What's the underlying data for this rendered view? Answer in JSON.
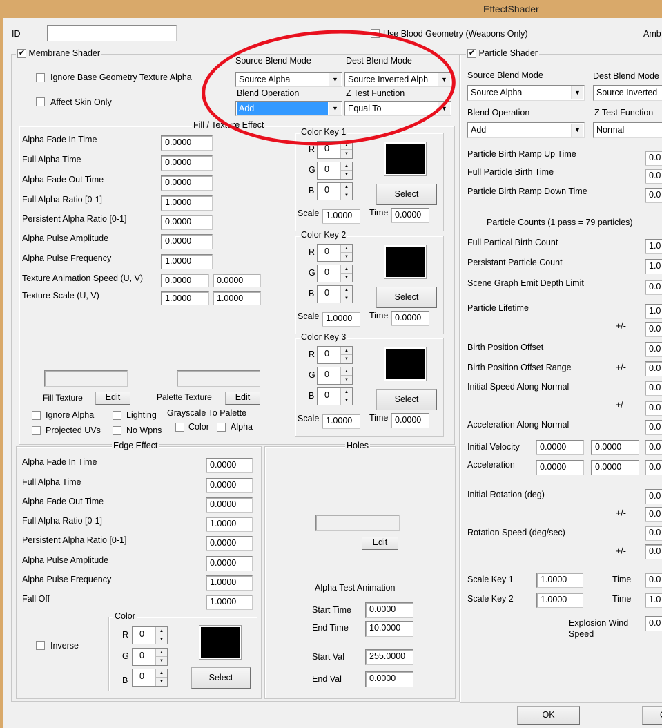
{
  "window": {
    "title": "EffectShader"
  },
  "top": {
    "id_label": "ID",
    "id_value": "",
    "use_blood_geometry": {
      "label": "Use Blood Geometry (Weapons Only)",
      "checked": false
    },
    "ambient_label": "Amb"
  },
  "membrane": {
    "label": "Membrane Shader",
    "checked": true,
    "ignore_base_geometry": {
      "label": "Ignore Base Geometry Texture Alpha",
      "checked": false
    },
    "affect_skin_only": {
      "label": "Affect Skin Only",
      "checked": false
    },
    "source_blend_label": "Source Blend Mode",
    "source_blend_value": "Source Alpha",
    "dest_blend_label": "Dest Blend Mode",
    "dest_blend_value": "Source Inverted Alph",
    "blend_op_label": "Blend Operation",
    "blend_op_value": "Add",
    "ztest_label": "Z Test Function",
    "ztest_value": "Equal To",
    "fill": {
      "title": "Fill / Texture Effect",
      "rows": [
        {
          "label": "Alpha Fade In Time",
          "value": "0.0000"
        },
        {
          "label": "Full Alpha Time",
          "value": "0.0000"
        },
        {
          "label": "Alpha Fade Out Time",
          "value": "0.0000"
        },
        {
          "label": "Full Alpha Ratio [0-1]",
          "value": "1.0000"
        },
        {
          "label": "Persistent Alpha Ratio [0-1]",
          "value": "0.0000"
        },
        {
          "label": "Alpha Pulse Amplitude",
          "value": "0.0000"
        },
        {
          "label": "Alpha Pulse Frequency",
          "value": "1.0000"
        }
      ],
      "anim_speed": {
        "label": "Texture Animation Speed (U, V)",
        "u": "0.0000",
        "v": "0.0000"
      },
      "tex_scale": {
        "label": "Texture Scale (U, V)",
        "u": "1.0000",
        "v": "1.0000"
      },
      "fill_texture_label": "Fill Texture",
      "fill_texture_value": "",
      "palette_texture_label": "Palette Texture",
      "palette_texture_value": "",
      "edit_label": "Edit",
      "ignore_alpha": {
        "label": "Ignore Alpha",
        "checked": false
      },
      "lighting": {
        "label": "Lighting",
        "checked": false
      },
      "projected_uvs": {
        "label": "Projected UVs",
        "checked": false
      },
      "no_wpns": {
        "label": "No Wpns",
        "checked": false
      },
      "grayscale_label": "Grayscale To Palette",
      "gs_color": {
        "label": "Color",
        "checked": false
      },
      "gs_alpha": {
        "label": "Alpha",
        "checked": false
      }
    },
    "color_keys": [
      {
        "title": "Color Key 1",
        "r": "0",
        "g": "0",
        "b": "0",
        "scale": "1.0000",
        "time": "0.0000",
        "color": "#000000"
      },
      {
        "title": "Color Key 2",
        "r": "0",
        "g": "0",
        "b": "0",
        "scale": "1.0000",
        "time": "0.0000",
        "color": "#000000"
      },
      {
        "title": "Color Key 3",
        "r": "0",
        "g": "0",
        "b": "0",
        "scale": "1.0000",
        "time": "0.0000",
        "color": "#000000"
      }
    ],
    "ck_labels": {
      "r": "R",
      "g": "G",
      "b": "B",
      "scale": "Scale",
      "time": "Time",
      "select": "Select"
    },
    "edge": {
      "title": "Edge Effect",
      "rows": [
        {
          "label": "Alpha Fade In Time",
          "value": "0.0000"
        },
        {
          "label": "Full Alpha Time",
          "value": "0.0000"
        },
        {
          "label": "Alpha Fade Out Time",
          "value": "0.0000"
        },
        {
          "label": "Full Alpha Ratio [0-1]",
          "value": "1.0000"
        },
        {
          "label": "Persistent Alpha Ratio [0-1]",
          "value": "0.0000"
        },
        {
          "label": "Alpha Pulse Amplitude",
          "value": "0.0000"
        },
        {
          "label": "Alpha Pulse Frequency",
          "value": "1.0000"
        },
        {
          "label": "Fall Off",
          "value": "1.0000"
        }
      ],
      "inverse": {
        "label": "Inverse",
        "checked": false
      },
      "color": {
        "title": "Color",
        "r": "0",
        "g": "0",
        "b": "0",
        "color": "#000000"
      }
    },
    "holes": {
      "title": "Holes",
      "texture_value": "",
      "edit_label": "Edit",
      "alpha_test_label": "Alpha Test Animation",
      "start_time_label": "Start Time",
      "start_time": "0.0000",
      "end_time_label": "End Time",
      "end_time": "10.0000",
      "start_val_label": "Start Val",
      "start_val": "255.0000",
      "end_val_label": "End Val",
      "end_val": "0.0000"
    }
  },
  "particle": {
    "label": "Particle Shader",
    "checked": true,
    "source_blend_label": "Source Blend Mode",
    "source_blend_value": "Source Alpha",
    "dest_blend_label": "Dest Blend Mode",
    "dest_blend_value": "Source Inverted",
    "blend_op_label": "Blend Operation",
    "blend_op_value": "Add",
    "ztest_label": "Z Test Function",
    "ztest_value": "Normal",
    "birth_rows": [
      {
        "label": "Particle Birth Ramp Up Time",
        "value": "0.0"
      },
      {
        "label": "Full Particle Birth Time",
        "value": "0.0"
      },
      {
        "label": "Particle Birth Ramp Down Time",
        "value": "0.0"
      }
    ],
    "counts_label": "Particle Counts (1 pass = 79 particles)",
    "count_rows": [
      {
        "label": "Full Partical Birth Count",
        "value": "1.0"
      },
      {
        "label": "Persistant Particle Count",
        "value": "1.0"
      },
      {
        "label": "Scene Graph Emit Depth Limit",
        "value": "0.0"
      }
    ],
    "plusminus": "+/-",
    "lifetime": {
      "label": "Particle Lifetime",
      "value": "1.0",
      "pm": "0.0"
    },
    "birth_pos_offset": {
      "label": "Birth Position Offset",
      "value": "0.0"
    },
    "birth_pos_range": {
      "label": "Birth Position Offset Range",
      "value": "0.0"
    },
    "init_speed": {
      "label": "Initial Speed Along Normal",
      "value": "0.0",
      "pm": "0.0"
    },
    "accel_normal": {
      "label": "Acceleration Along Normal",
      "value": "0.0"
    },
    "init_velocity": {
      "label": "Initial Velocity",
      "x": "0.0000",
      "y": "0.0000",
      "z": "0.0"
    },
    "acceleration": {
      "label": "Acceleration",
      "x": "0.0000",
      "y": "0.0000",
      "z": "0.0"
    },
    "init_rotation": {
      "label": "Initial Rotation (deg)",
      "value": "0.0",
      "pm": "0.0"
    },
    "rot_speed": {
      "label": "Rotation Speed (deg/sec)",
      "value": "0.0",
      "pm": "0.0"
    },
    "scale_key1": {
      "label": "Scale Key 1",
      "value": "1.0000",
      "time_label": "Time",
      "time": "0.0"
    },
    "scale_key2": {
      "label": "Scale Key 2",
      "value": "1.0000",
      "time_label": "Time",
      "time": "1.0"
    },
    "explosion": {
      "label": "Explosion Wind Speed",
      "value": "0.0"
    }
  },
  "buttons": {
    "ok": "OK",
    "cancel": "C"
  }
}
